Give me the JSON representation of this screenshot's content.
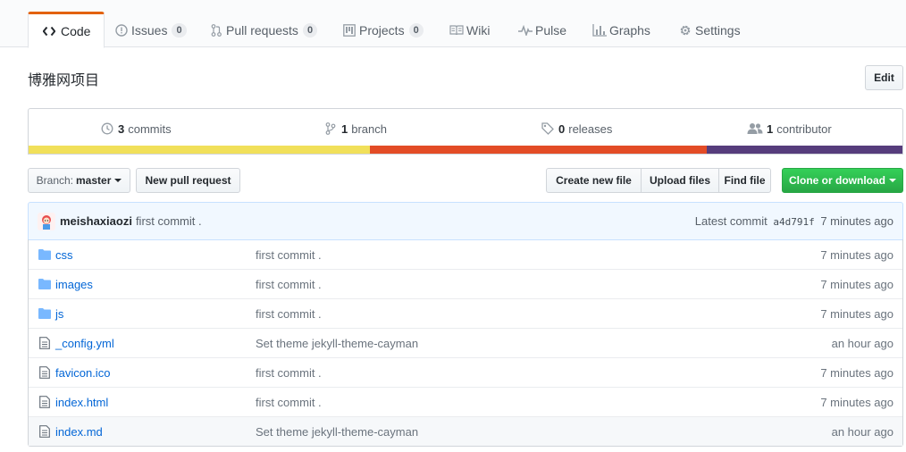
{
  "tabs": [
    {
      "label": "Code",
      "icon": "code-icon",
      "counter": null,
      "selected": true
    },
    {
      "label": "Issues",
      "icon": "issue-opened-icon",
      "counter": "0"
    },
    {
      "label": "Pull requests",
      "icon": "git-pull-request-icon",
      "counter": "0"
    },
    {
      "label": "Projects",
      "icon": "project-icon",
      "counter": "0"
    },
    {
      "label": "Wiki",
      "icon": "book-icon",
      "counter": null
    },
    {
      "label": "Pulse",
      "icon": "pulse-icon",
      "counter": null
    },
    {
      "label": "Graphs",
      "icon": "graph-icon",
      "counter": null
    },
    {
      "label": "Settings",
      "icon": "gear-icon",
      "counter": null
    }
  ],
  "repo": {
    "description": "博雅网项目",
    "edit_label": "Edit"
  },
  "summary": {
    "commits_count": "3",
    "commits_label": "commits",
    "branch_count": "1",
    "branch_label": "branch",
    "releases_count": "0",
    "releases_label": "releases",
    "contributor_count": "1",
    "contributor_label": "contributor"
  },
  "language_bar": [
    {
      "color": "#f1e05a",
      "percent": 39
    },
    {
      "color": "#e34c26",
      "percent": 38.4
    },
    {
      "color": "#563d7c",
      "percent": 22.6
    }
  ],
  "toolbar": {
    "branch_prefix": "Branch:",
    "branch_name": "master",
    "new_pull_request": "New pull request",
    "create_new_file": "Create new file",
    "upload_files": "Upload files",
    "find_file": "Find file",
    "clone_or_download": "Clone or download"
  },
  "latest_commit": {
    "author": "meishaxiaozi",
    "message": "first commit .",
    "label": "Latest commit",
    "sha": "a4d791f",
    "age": "7 minutes ago"
  },
  "files": [
    {
      "type": "dir",
      "name": "css",
      "message": "first commit .",
      "age": "7 minutes ago"
    },
    {
      "type": "dir",
      "name": "images",
      "message": "first commit .",
      "age": "7 minutes ago"
    },
    {
      "type": "dir",
      "name": "js",
      "message": "first commit .",
      "age": "7 minutes ago"
    },
    {
      "type": "file",
      "name": "_config.yml",
      "message": "Set theme jekyll-theme-cayman",
      "age": "an hour ago"
    },
    {
      "type": "file",
      "name": "favicon.ico",
      "message": "first commit .",
      "age": "7 minutes ago"
    },
    {
      "type": "file",
      "name": "index.html",
      "message": "first commit .",
      "age": "7 minutes ago"
    },
    {
      "type": "file",
      "name": "index.md",
      "message": "Set theme jekyll-theme-cayman",
      "age": "an hour ago"
    }
  ]
}
